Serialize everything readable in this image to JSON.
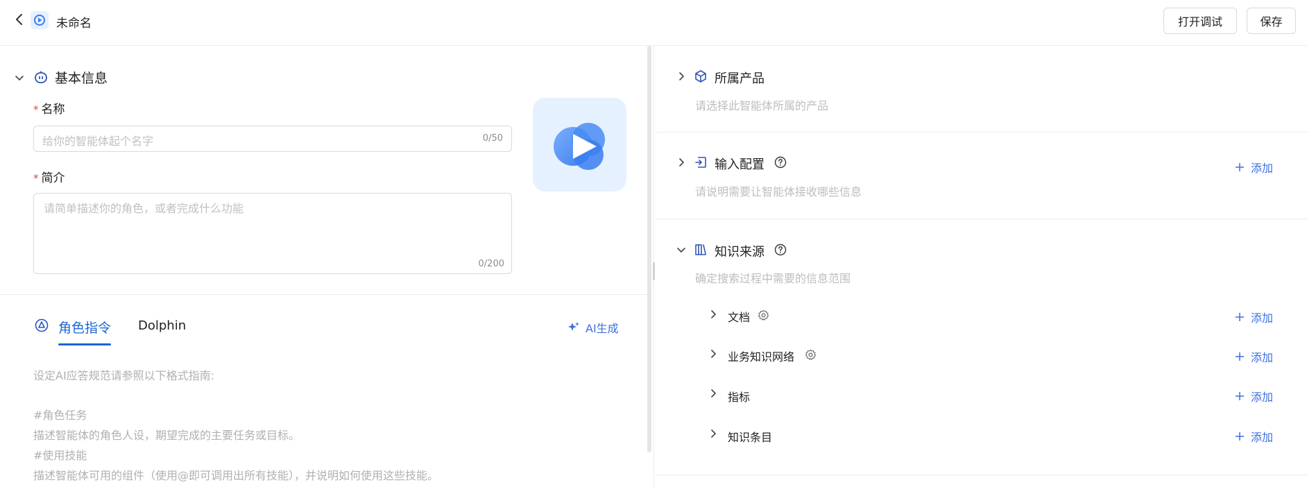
{
  "header": {
    "title": "未命名",
    "debug_button": "打开调试",
    "save_button": "保存"
  },
  "basic_info": {
    "section_title": "基本信息",
    "name_label": "名称",
    "name_placeholder": "给你的智能体起个名字",
    "name_count": "0/50",
    "intro_label": "简介",
    "intro_placeholder": "请简单描述你的角色，或者完成什么功能",
    "intro_count": "0/200",
    "required_mark": "*"
  },
  "tabs": {
    "role": "角色指令",
    "dolphin": "Dolphin",
    "ai_generate": "AI生成"
  },
  "prompt_lines": [
    "设定AI应答规范请参照以下格式指南:",
    "#角色任务",
    "描述智能体的角色人设，期望完成的主要任务或目标。",
    "#使用技能",
    "描述智能体可用的组件（使用@即可调用出所有技能），并说明如何使用这些技能。"
  ],
  "right": {
    "product": {
      "title": "所属产品",
      "desc": "请选择此智能体所属的产品"
    },
    "input_config": {
      "title": "输入配置",
      "desc": "请说明需要让智能体接收哪些信息",
      "add": "添加"
    },
    "knowledge": {
      "title": "知识来源",
      "desc": "确定搜索过程中需要的信息范围",
      "items": [
        {
          "label": "文档",
          "add": "添加"
        },
        {
          "label": "业务知识网络",
          "add": "添加"
        },
        {
          "label": "指标",
          "add": "添加"
        },
        {
          "label": "知识条目",
          "add": "添加"
        }
      ]
    }
  },
  "colors": {
    "accent": "#1a66d6",
    "link": "#3a6fe0",
    "required": "#e64545",
    "placeholder": "#c0c0c0",
    "border": "#d9d9d9"
  }
}
